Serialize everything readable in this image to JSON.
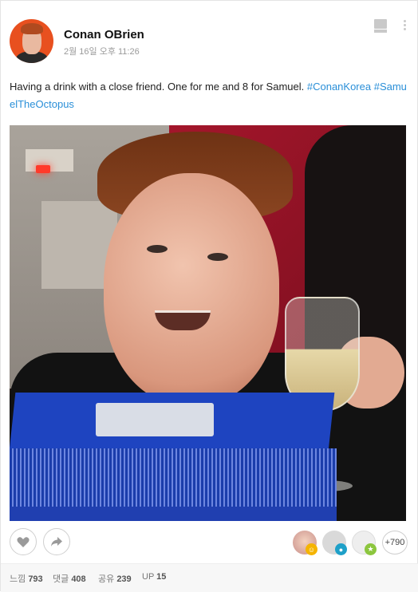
{
  "post": {
    "author": "Conan OBrien",
    "timestamp": "2월 16일 오후 11:26",
    "caption_text": "Having a drink with a close friend. One for me and 8 for Samuel. ",
    "hashtags": [
      "#ConanKorea",
      "#SamuelTheOctopus"
    ],
    "hashtag_color": "#2a8fd8"
  },
  "actions": {
    "like_icon": "heart-icon",
    "share_icon": "share-arrow-icon",
    "reaction_count": "+790"
  },
  "stats": {
    "feel_label": "느낌",
    "feel_count": "793",
    "comment_label": "댓글",
    "comment_count": "408",
    "share_label": "공유",
    "share_count": "239",
    "up_label": "UP",
    "up_count": "15"
  },
  "colors": {
    "avatar_bg": "#e8501f",
    "badge_yellow": "#f5b400",
    "badge_blue": "#1ea0c8",
    "badge_green": "#8cc63e"
  }
}
